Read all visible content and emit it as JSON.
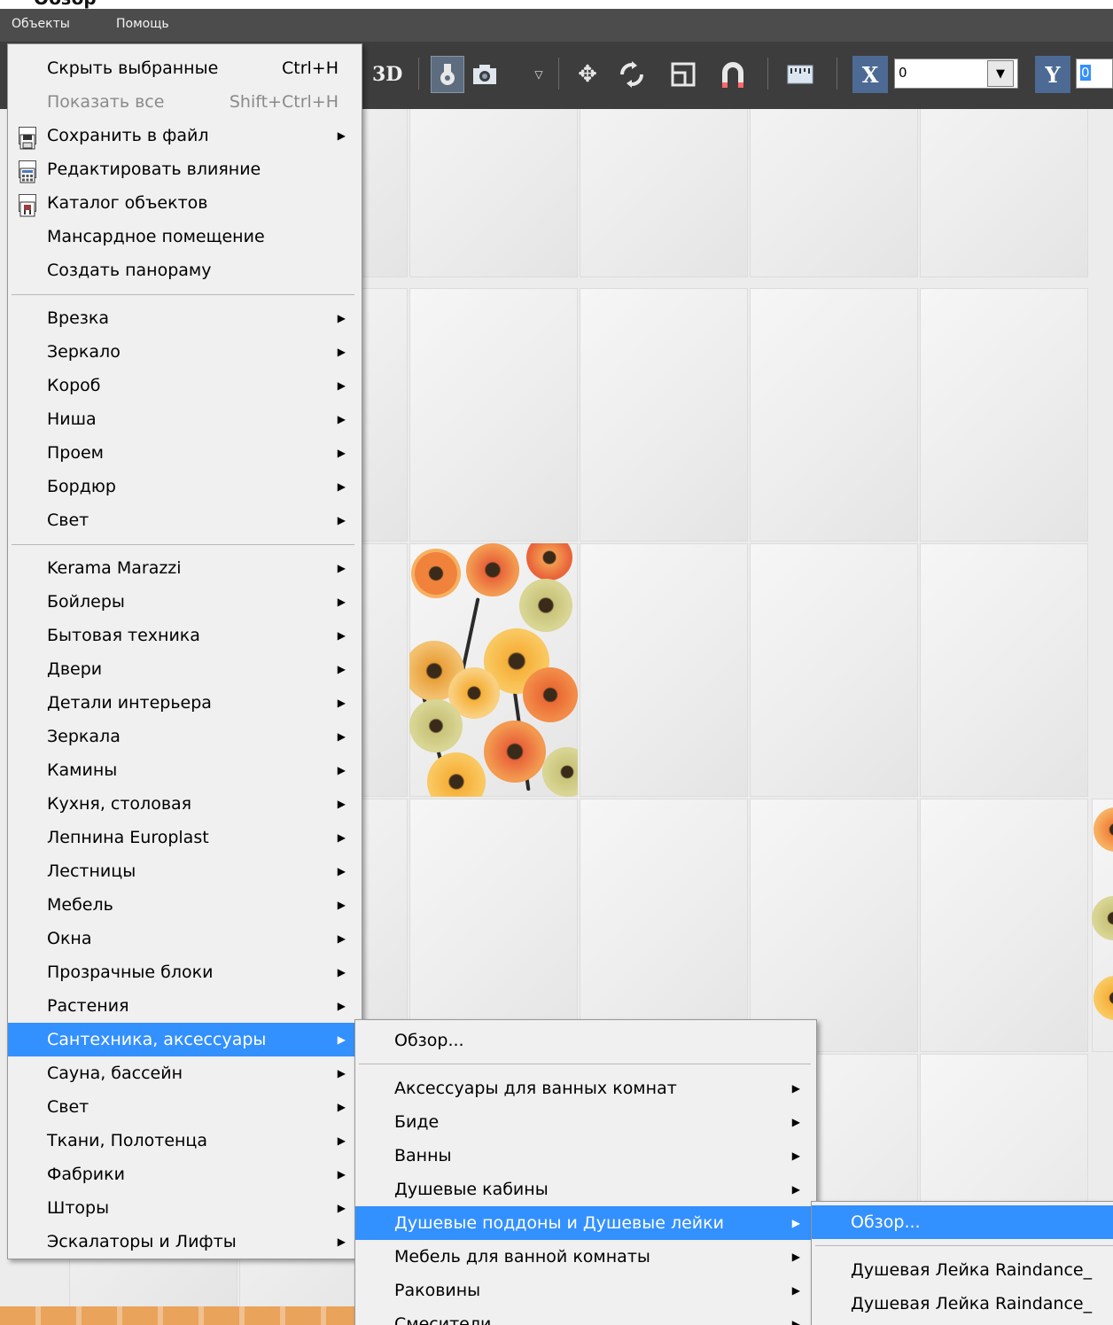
{
  "header": {
    "cut_title": "Обзор\""
  },
  "menubar": {
    "items": [
      "Объекты",
      "Помощь"
    ]
  },
  "toolbar": {
    "mode_3d": "3D",
    "x_label": "X",
    "x_value": "0",
    "y_label": "Y",
    "y_value": "0"
  },
  "objects_menu": {
    "top_items": [
      {
        "label": "Скрыть выбранные",
        "shortcut": "Ctrl+H"
      },
      {
        "label": "Показать все",
        "shortcut": "Shift+Ctrl+H",
        "disabled": true
      },
      {
        "label": "Сохранить в файл",
        "icon": "save-icon",
        "submenu": true
      },
      {
        "label": "Редактировать влияние",
        "icon": "calculator-icon"
      },
      {
        "label": "Каталог объектов",
        "icon": "catalog-icon"
      },
      {
        "label": "Мансардное помещение"
      },
      {
        "label": "Создать панораму"
      }
    ],
    "construction_items": [
      "Врезка",
      "Зеркало",
      "Короб",
      "Ниша",
      "Проем",
      "Бордюр",
      "Свет"
    ],
    "catalog_items": [
      "Kerama Marazzi",
      "Бойлеры",
      "Бытовая техника",
      "Двери",
      "Детали интерьера",
      "Зеркала",
      "Камины",
      "Кухня, столовая",
      "Лепнина Europlast",
      "Лестницы",
      "Мебель",
      "Окна",
      "Прозрачные блоки",
      "Растения",
      "Сантехника, аксессуары",
      "Сауна, бассейн",
      "Свет",
      "Ткани, Полотенца",
      "Фабрики",
      "Шторы",
      "Эскалаторы и Лифты"
    ],
    "highlighted": "Сантехника, аксессуары"
  },
  "plumbing_menu": {
    "browse": "Обзор...",
    "items": [
      "Аксессуары  для ванных комнат",
      "Биде",
      "Ванны",
      "Душевые кабины",
      "Душевые поддоны и Душевые лейки",
      "Мебель для ванной комнаты",
      "Раковины",
      "Смесители"
    ],
    "highlighted": "Душевые поддоны и Душевые лейки"
  },
  "shower_menu": {
    "browse": "Обзор...",
    "items": [
      "Душевая Лейка Raindance_",
      "Душевая Лейка Raindance_"
    ]
  }
}
